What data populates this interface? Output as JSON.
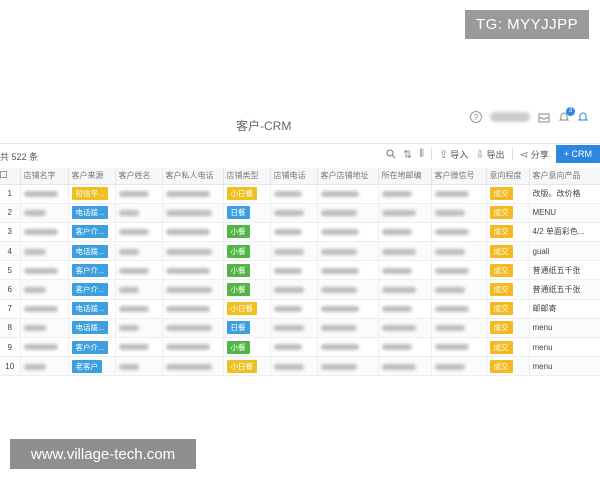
{
  "watermarks": {
    "top": "TG: MYYJJPP",
    "bottom": "www.village-tech.com"
  },
  "header": {
    "title": "客户-CRM",
    "notification_count": "3"
  },
  "toolbar": {
    "record_count": "共 522 条",
    "import_label": "导入",
    "export_label": "导出",
    "share_label": "分享",
    "add_label": "+ CRM"
  },
  "columns": [
    "店铺名字",
    "客户来源",
    "客户姓名",
    "客户私人电话",
    "店铺类型",
    "店铺电话",
    "客户店铺地址",
    "所在地邮编",
    "客户微信号",
    "意向程度",
    "客户意向产品"
  ],
  "rows": [
    {
      "index": "1",
      "source": "短信平...",
      "source_color": "yellow",
      "type": "小日餐",
      "type_color": "yellow",
      "intent": "成交",
      "product": "改版。改价格"
    },
    {
      "index": "2",
      "source": "电话拨...",
      "source_color": "blue",
      "type": "日餐",
      "type_color": "blue",
      "intent": "成交",
      "product": "MENU"
    },
    {
      "index": "3",
      "source": "客户介...",
      "source_color": "blue",
      "type": "小餐",
      "type_color": "green",
      "intent": "成交",
      "product": "4/2 单面彩色..."
    },
    {
      "index": "4",
      "source": "电话拨...",
      "source_color": "blue",
      "type": "小餐",
      "type_color": "green",
      "intent": "成交",
      "product": "guali"
    },
    {
      "index": "5",
      "source": "客户介...",
      "source_color": "blue",
      "type": "小餐",
      "type_color": "green",
      "intent": "成交",
      "product": "普通纸五千张"
    },
    {
      "index": "6",
      "source": "客户介...",
      "source_color": "blue",
      "type": "小餐",
      "type_color": "green",
      "intent": "成交",
      "product": "普通纸五千张"
    },
    {
      "index": "7",
      "source": "电话拨...",
      "source_color": "blue",
      "type": "小日餐",
      "type_color": "yellow",
      "intent": "成交",
      "product": "邮邮寄"
    },
    {
      "index": "8",
      "source": "电话拨...",
      "source_color": "blue",
      "type": "日餐",
      "type_color": "blue",
      "intent": "成交",
      "product": "menu"
    },
    {
      "index": "9",
      "source": "客户介...",
      "source_color": "blue",
      "type": "小餐",
      "type_color": "green",
      "intent": "成交",
      "product": "menu"
    },
    {
      "index": "10",
      "source": "老客户",
      "source_color": "blue",
      "type": "小日餐",
      "type_color": "yellow",
      "intent": "成交",
      "product": "menu"
    }
  ],
  "colors": {
    "accent": "#2d87de",
    "tag_blue": "#3d9fe0",
    "tag_yellow": "#f0c020",
    "tag_green": "#52b546"
  }
}
